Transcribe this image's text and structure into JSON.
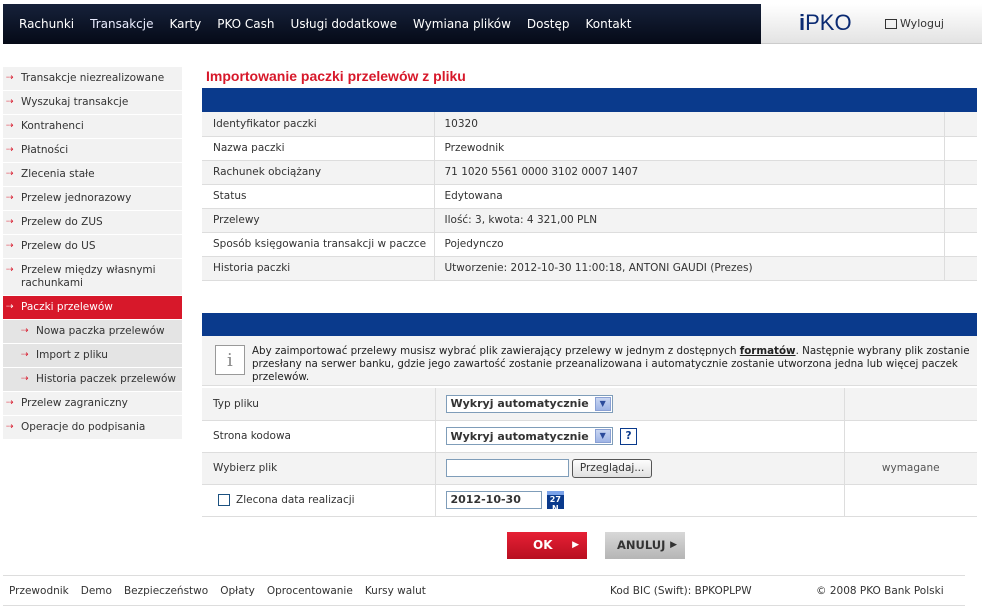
{
  "topnav": {
    "items": [
      "Rachunki",
      "Transakcje",
      "Karty",
      "PKO Cash",
      "Usługi dodatkowe",
      "Wymiana plików",
      "Dostęp",
      "Kontakt"
    ],
    "active": "Transakcje"
  },
  "brand": {
    "logo": "iPKO",
    "logo_prefix": "i",
    "logo_rest": "PKO",
    "logout_label": "Wyloguj"
  },
  "sidebar": {
    "items": [
      {
        "label": "Transakcje niezrealizowane"
      },
      {
        "label": "Wyszukaj transakcje"
      },
      {
        "label": "Kontrahenci"
      },
      {
        "label": "Płatności"
      },
      {
        "label": "Zlecenia stałe"
      },
      {
        "label": "Przelew jednorazowy"
      },
      {
        "label": "Przelew do ZUS"
      },
      {
        "label": "Przelew do US"
      },
      {
        "label": "Przelew między własnymi rachunkami"
      },
      {
        "label": "Paczki przelewów"
      },
      {
        "label": "Nowa paczka przelewów"
      },
      {
        "label": "Import z pliku"
      },
      {
        "label": "Historia paczek przelewów"
      },
      {
        "label": "Przelew zagraniczny"
      },
      {
        "label": "Operacje do podpisania"
      }
    ],
    "active": "Paczki przelewów",
    "arrow": "⇢"
  },
  "main": {
    "title": "Importowanie paczki przelewów z pliku",
    "details": [
      {
        "label": "Identyfikator paczki",
        "value": "10320"
      },
      {
        "label": "Nazwa paczki",
        "value": "Przewodnik"
      },
      {
        "label": "Rachunek obciążany",
        "value": "71 1020 5561 0000 3102 0007 1407"
      },
      {
        "label": "Status",
        "value": "Edytowana"
      },
      {
        "label": "Przelewy",
        "value": "Ilość: 3, kwota: 4 321,00 PLN"
      },
      {
        "label": "Sposób księgowania transakcji w paczce",
        "value": "Pojedynczo"
      },
      {
        "label": "Historia paczki",
        "value": "Utworzenie: 2012-10-30 11:00:18, ANTONI GAUDI (Prezes)"
      }
    ],
    "notice": {
      "icon_letter": "i",
      "text_before": "Aby zaimportować przelewy musisz wybrać plik zawierający przelewy w jednym z dostępnych ",
      "link": "formatów",
      "text_after": ". Następnie wybrany plik zostanie przesłany na serwer banku, gdzie jego zawartość zostanie przeanalizowana i automatycznie zostanie utworzona jedna lub więcej paczek przelewów."
    },
    "form": {
      "file_type": {
        "label": "Typ pliku",
        "value": "Wykryj automatycznie"
      },
      "encoding": {
        "label": "Strona kodowa",
        "value": "Wykryj automatycznie",
        "help": "?"
      },
      "file": {
        "label": "Wybierz plik",
        "value": "",
        "browse_label": "Przeglądaj...",
        "required": "wymagane"
      },
      "date": {
        "label": "Zlecona data realizacji",
        "value": "2012-10-30",
        "checked": false,
        "cal_top": "27",
        "cal_bottom": "N"
      }
    },
    "buttons": {
      "ok": "OK",
      "cancel": "ANULUJ",
      "arrow": "▶"
    }
  },
  "footer": {
    "links": [
      "Przewodnik",
      "Demo",
      "Bezpieczeństwo",
      "Opłaty",
      "Oprocentowanie",
      "Kursy walut"
    ],
    "bic": "Kod BIC (Swift): BPKOPLPW",
    "copyright": "© 2008 PKO Bank Polski"
  },
  "colors": {
    "primary_blue": "#0a3a8c",
    "brand_red": "#d7182a",
    "nav_bg": "#0b1325"
  }
}
